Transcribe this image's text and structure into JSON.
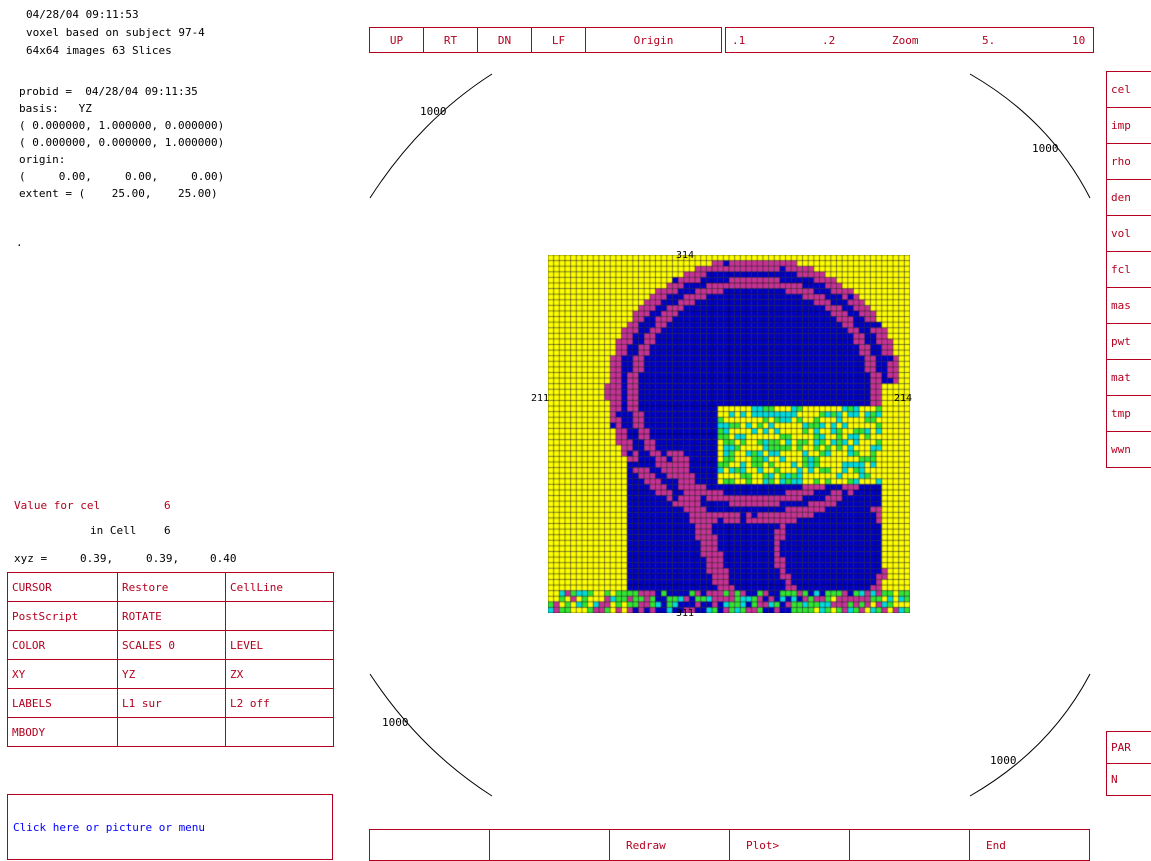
{
  "info": {
    "timestamp": "04/28/04 09:11:53",
    "subject": "voxel based on subject 97-4",
    "images": "64x64 images 63 Slices",
    "probid": "probid =  04/28/04 09:11:35",
    "basis": "basis:   YZ",
    "vec1": "( 0.000000, 1.000000, 0.000000)",
    "vec2": "( 0.000000, 0.000000, 1.000000)",
    "origin_label": "origin:",
    "origin_value": "(     0.00,     0.00,     0.00)",
    "extent": "extent = (    25.00,    25.00)",
    "dot": "."
  },
  "value": {
    "label": "Value for cel",
    "value": "6",
    "in_cell_label": "in Cell",
    "in_cell_value": "6",
    "xyz_label": "xyz =",
    "x": "0.39,",
    "y": "0.39,",
    "z": "0.40"
  },
  "menu_grid": [
    [
      "CURSOR",
      "Restore",
      "CellLine"
    ],
    [
      "PostScript",
      "ROTATE",
      ""
    ],
    [
      "COLOR",
      "SCALES 0",
      "LEVEL"
    ],
    [
      "XY",
      "YZ",
      "ZX"
    ],
    [
      "LABELS",
      "L1 sur",
      "L2 off"
    ],
    [
      "MBODY",
      "",
      ""
    ]
  ],
  "message": "Click here or picture or menu",
  "top_nav": [
    "UP",
    "RT",
    "DN",
    "LF",
    "Origin"
  ],
  "zoom": {
    "label": "Zoom",
    "levels": [
      ".1",
      ".2",
      "5.",
      "10"
    ]
  },
  "side_menu": [
    "cel",
    "imp",
    "rho",
    "den",
    "vol",
    "fcl",
    "mas",
    "pwt",
    "mat",
    "tmp",
    "wwn"
  ],
  "side_menu_bottom": [
    "PAR",
    "N"
  ],
  "bottom_bar": [
    "",
    "",
    "Redraw",
    "Plot>",
    "",
    "End"
  ],
  "ring_labels": [
    "1000",
    "1000",
    "1000",
    "1000"
  ],
  "edge_labels": {
    "top": "314",
    "bottom": "311",
    "left": "211",
    "right": "214"
  },
  "colors": {
    "frame": "#b4001e",
    "message_text": "#0000ff",
    "image_blue": "#0000c8",
    "image_yellow": "#ffff00",
    "image_magenta": "#c83296",
    "image_pink": "#ff96d2",
    "image_cyan": "#00dcdc",
    "image_green": "#32e632",
    "image_orange": "#ffb400",
    "image_grid": "#000000"
  }
}
